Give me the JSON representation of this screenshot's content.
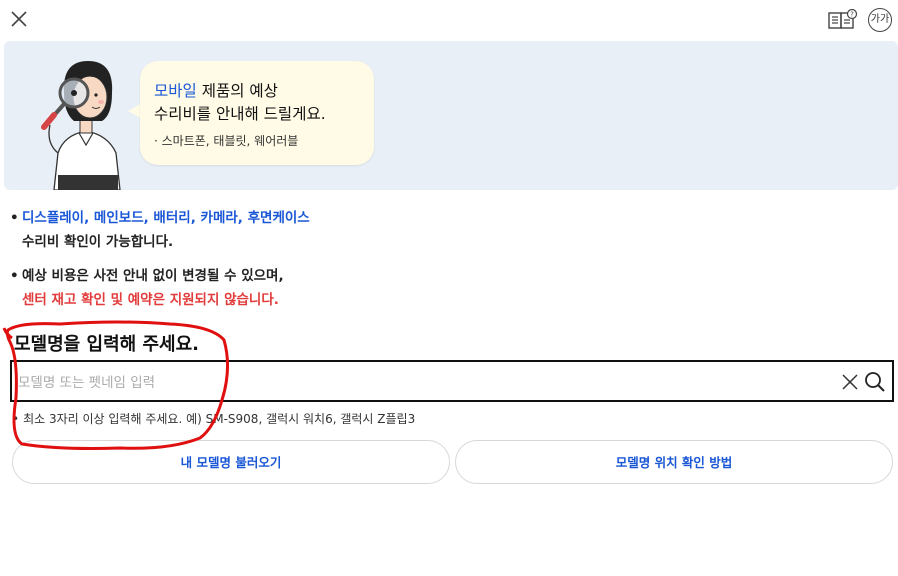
{
  "header": {
    "close_icon": "close-icon",
    "guide_icon": "book-question-icon",
    "font_size_label": "가가"
  },
  "banner": {
    "line1_highlight": "모바일",
    "line1_rest": " 제품의 예상",
    "line2": "수리비를 안내해 드릴게요.",
    "sub": "· 스마트폰, 태블릿, 웨어러블",
    "highlight_color": "#1a57d6",
    "background_color": "#e8eff7"
  },
  "notes": [
    {
      "bullet": "•",
      "line1": "디스플레이, 메인보드, 배터리, 카메라, 후면케이스",
      "line2": "수리비 확인이 가능합니다."
    },
    {
      "bullet": "•",
      "line1": "예상 비용은 사전 안내 없이 변경될 수 있으며,",
      "line2": "센터 재고 확인 및 예약은 지원되지 않습니다."
    }
  ],
  "model": {
    "title": "모델명을 입력해 주세요.",
    "placeholder": "모델명 또는 펫네임 입력",
    "value": "",
    "hint_bullet": "•",
    "hint": "최소 3자리 이상 입력해 주세요. 예) SM-S908, 갤럭시 워치6, 갤럭시 Z플립3"
  },
  "buttons": {
    "load_model": "내 모델명 불러오기",
    "find_model": "모델명 위치 확인 방법"
  },
  "colors": {
    "accent_blue": "#1a57d6",
    "warning_red": "#e23b3b",
    "annotation_red": "#e01010"
  }
}
